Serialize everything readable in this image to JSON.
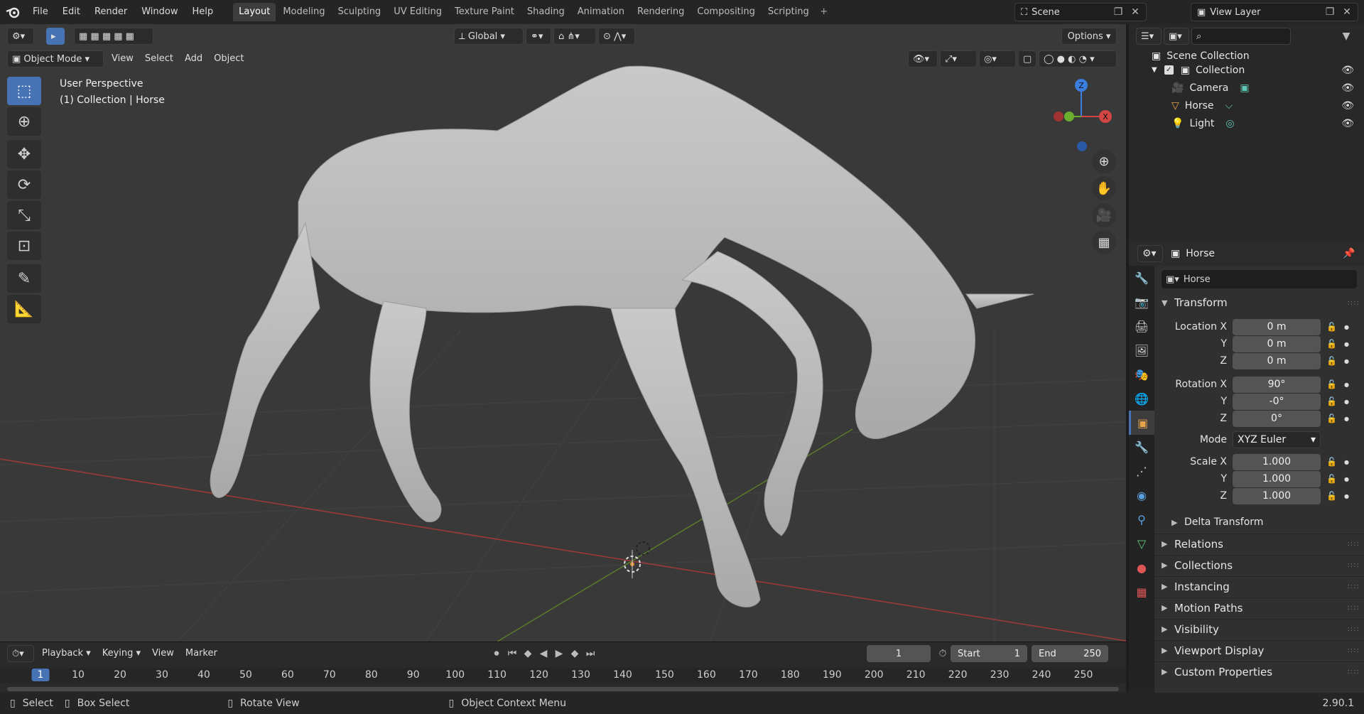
{
  "menu": [
    "File",
    "Edit",
    "Render",
    "Window",
    "Help"
  ],
  "workspaces": [
    "Layout",
    "Modeling",
    "Sculpting",
    "UV Editing",
    "Texture Paint",
    "Shading",
    "Animation",
    "Rendering",
    "Compositing",
    "Scripting"
  ],
  "active_workspace": "Layout",
  "scene": "Scene",
  "view_layer": "View Layer",
  "viewport": {
    "mode": "Object Mode",
    "menus": [
      "View",
      "Select",
      "Add",
      "Object"
    ],
    "orientation": "Global",
    "options": "Options",
    "overlay_line1": "User Perspective",
    "overlay_line2": "(1) Collection | Horse",
    "gizmo": {
      "z": "Z",
      "x": "X"
    }
  },
  "outliner": {
    "root": "Scene Collection",
    "collection": "Collection",
    "items": [
      "Camera",
      "Horse",
      "Light"
    ]
  },
  "properties": {
    "object_name": "Horse",
    "data_name": "Horse",
    "transform_label": "Transform",
    "location": {
      "label": "Location X",
      "x": "0 m",
      "y": "0 m",
      "z": "0 m"
    },
    "rotation": {
      "label": "Rotation X",
      "x": "90°",
      "y": "-0°",
      "z": "0°"
    },
    "mode_label": "Mode",
    "mode": "XYZ Euler",
    "scale": {
      "label": "Scale X",
      "x": "1.000",
      "y": "1.000",
      "z": "1.000"
    },
    "axis_y": "Y",
    "axis_z": "Z",
    "delta": "Delta Transform",
    "sections": [
      "Relations",
      "Collections",
      "Instancing",
      "Motion Paths",
      "Visibility",
      "Viewport Display",
      "Custom Properties"
    ]
  },
  "timeline": {
    "menus": [
      "Playback",
      "Keying",
      "View",
      "Marker"
    ],
    "current_frame": "1",
    "start_label": "Start",
    "start": "1",
    "end_label": "End",
    "end": "250",
    "ticks": [
      "1",
      "10",
      "20",
      "30",
      "40",
      "50",
      "60",
      "70",
      "80",
      "90",
      "100",
      "110",
      "120",
      "130",
      "140",
      "150",
      "160",
      "170",
      "180",
      "190",
      "200",
      "210",
      "220",
      "230",
      "240",
      "250"
    ]
  },
  "status": {
    "select": "Select",
    "box_select": "Box Select",
    "rotate": "Rotate View",
    "context": "Object Context Menu",
    "version": "2.90.1"
  },
  "colors": {
    "accent": "#4772b3",
    "bg": "#393939",
    "panel": "#303030"
  }
}
